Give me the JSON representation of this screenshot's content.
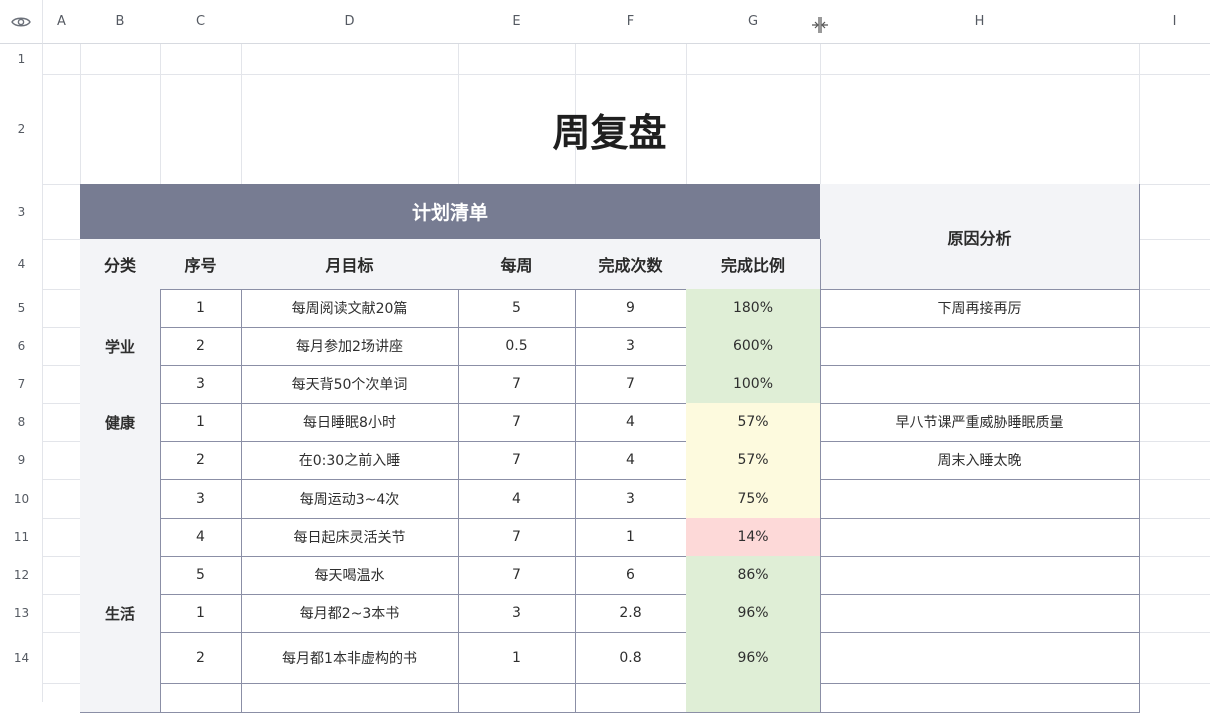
{
  "columns": [
    "A",
    "B",
    "C",
    "D",
    "E",
    "F",
    "G",
    "H",
    "I"
  ],
  "rows": [
    "1",
    "2",
    "3",
    "4",
    "5",
    "6",
    "7",
    "8",
    "9",
    "10",
    "11",
    "12",
    "13",
    "14"
  ],
  "icons": {
    "visibility": "eye-icon",
    "resize": "column-resize-icon"
  },
  "sheet": {
    "title": "周复盘",
    "plan_header": "计划清单",
    "reason_header": "原因分析",
    "headers": {
      "category": "分类",
      "index": "序号",
      "goal": "月目标",
      "weekly": "每周",
      "done": "完成次数",
      "ratio": "完成比例"
    },
    "categories": {
      "study": "学业",
      "health": "健康",
      "life": "生活"
    },
    "records": [
      {
        "index": "1",
        "goal": "每周阅读文献20篇",
        "weekly": "5",
        "done": "9",
        "ratio": "180%",
        "reason": "下周再接再厉"
      },
      {
        "index": "2",
        "goal": "每月参加2场讲座",
        "weekly": "0.5",
        "done": "3",
        "ratio": "600%",
        "reason": ""
      },
      {
        "index": "3",
        "goal": "每天背50个次单词",
        "weekly": "7",
        "done": "7",
        "ratio": "100%",
        "reason": ""
      },
      {
        "index": "1",
        "goal": "每日睡眠8小时",
        "weekly": "7",
        "done": "4",
        "ratio": "57%",
        "reason": "早八节课严重威胁睡眠质量"
      },
      {
        "index": "2",
        "goal": "在0:30之前入睡",
        "weekly": "7",
        "done": "4",
        "ratio": "57%",
        "reason": "周末入睡太晚"
      },
      {
        "index": "3",
        "goal": "每周运动3~4次",
        "weekly": "4",
        "done": "3",
        "ratio": "75%",
        "reason": ""
      },
      {
        "index": "4",
        "goal": "每日起床灵活关节",
        "weekly": "7",
        "done": "1",
        "ratio": "14%",
        "reason": ""
      },
      {
        "index": "5",
        "goal": "每天喝温水",
        "weekly": "7",
        "done": "6",
        "ratio": "86%",
        "reason": ""
      },
      {
        "index": "1",
        "goal": "每月都2~3本书",
        "weekly": "3",
        "done": "2.8",
        "ratio": "96%",
        "reason": ""
      },
      {
        "index": "2",
        "goal": "每月都1本非虚构的书",
        "weekly": "1",
        "done": "0.8",
        "ratio": "96%",
        "reason": ""
      }
    ],
    "ratio_colors": {
      "high": "#dfeed6",
      "mid": "#fdfade",
      "low": "#fdd9d8"
    },
    "header_color": "#777c92"
  }
}
